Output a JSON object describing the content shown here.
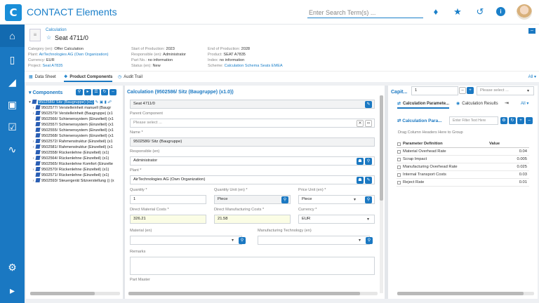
{
  "app": {
    "title": "CONTACT Elements",
    "logo_letter": "C",
    "search_placeholder": "Enter Search Term(s) ..."
  },
  "top_icons": [
    "bell-icon",
    "star-icon",
    "history-icon",
    "info-icon",
    "user-avatar"
  ],
  "sidebar": {
    "items": [
      "home-icon",
      "document-icon",
      "structure-icon",
      "monitor-icon",
      "checklist-icon",
      "pulse-icon",
      "settings-icon",
      "expand-icon"
    ]
  },
  "header": {
    "breadcrumb": "Calculation",
    "title": "Seat 4711/0",
    "col1": [
      {
        "label": "Category (en):",
        "value": "Offer Calculation",
        "link": false
      },
      {
        "label": "Plant:",
        "value": "AirTechnologies AG (Own Organization)",
        "link": true
      },
      {
        "label": "Currency:",
        "value": "EUR",
        "link": false
      },
      {
        "label": "Project:",
        "value": "Seat A7835",
        "link": true
      }
    ],
    "col2": [
      {
        "label": "Start of Production:",
        "value": "2023",
        "link": false
      },
      {
        "label": "Responsible (en):",
        "value": "Administrator",
        "link": false
      },
      {
        "label": "Part No.:",
        "value": "no information",
        "link": false
      },
      {
        "label": "Status (en):",
        "value": "New",
        "link": false
      }
    ],
    "col3": [
      {
        "label": "End of Production:",
        "value": "2028",
        "link": false
      },
      {
        "label": "Product:",
        "value": "SEAT A7835",
        "link": false
      },
      {
        "label": "Index:",
        "value": "no information",
        "link": false
      },
      {
        "label": "Scheme:",
        "value": "Calculation Schema Seats EMEA",
        "link": true
      }
    ],
    "tabs": [
      "Data Sheet",
      "Product Components",
      "Audit Trail"
    ],
    "active_tab": "Product Components",
    "tabs_filter": "All"
  },
  "components": {
    "title": "Components",
    "tree": [
      {
        "label": "9502586/ Sitz (Baugruppe) (x1)",
        "level": 0,
        "expanded": true,
        "selected": true
      },
      {
        "label": "9502577/ Verstelleinheit manuell (Baugr",
        "level": 1
      },
      {
        "label": "9502579/ Verstelleinheit (Baugruppe) (x1",
        "level": 1
      },
      {
        "label": "9502566/ Schienensystem (Einzelteil) (x1",
        "level": 1
      },
      {
        "label": "9502557/ Schienensystem (Einzelteil) (x1",
        "level": 1
      },
      {
        "label": "9502555/ Schienensystem (Einzelteil) (x1",
        "level": 1
      },
      {
        "label": "9502568/ Schienensystem (Einzelteil) (x1",
        "level": 1
      },
      {
        "label": "9502572/ Rahmenstruktur (Einzelteil) (x1",
        "level": 1
      },
      {
        "label": "9502581/ Rahmenstruktur (Einzelteil) (x1",
        "level": 1
      },
      {
        "label": "9502558/ Rückenlehne (Einzelteil) (x1)",
        "level": 1
      },
      {
        "label": "9502564/ Rückenlehne (Einzelteil) (x1)",
        "level": 1
      },
      {
        "label": "9502565/ Rückenlehne Komfort (Einzelte",
        "level": 1
      },
      {
        "label": "9502570/ Rückenlehne (Einzelteil) (x1)",
        "level": 1
      },
      {
        "label": "9502571/ Rückenlehne (Einzelteil) (x1)",
        "level": 1
      },
      {
        "label": "9502593/ Steuergerät Sitzverstellung () (x",
        "level": 1
      }
    ]
  },
  "calc": {
    "title": "Calculation (9502586/ Sitz (Baugruppe) (x1.0))",
    "top_value": "Seat 4711/0",
    "parent_label": "Parent Component",
    "parent_placeholder": "Please select ...",
    "name_label": "Name *",
    "name_value": "9502586/ Sitz (Baugruppe)",
    "responsible_label": "Responsible (en)",
    "responsible_value": "Administrator",
    "plant_label": "Plant *",
    "plant_value": "AirTechnologies AG (Own Organization)",
    "quantity_label": "Quantity *",
    "quantity_value": "1",
    "qunit_label": "Quantity Unit (en) *",
    "qunit_value": "Piece",
    "punit_label": "Price Unit (en) *",
    "punit_value": "Piece",
    "dmc_label": "Direct Material Costs *",
    "dmc_value": "326.21",
    "dmfc_label": "Direct Manufacturing Costs *",
    "dmfc_value": "21.58",
    "currency_label": "Currency *",
    "currency_value": "EUR",
    "material_label": "Material (en)",
    "mtech_label": "Manufacturing Technology (en)",
    "remarks_label": "Remarks",
    "partmaster_label": "Part Master"
  },
  "right": {
    "title": "Capit...",
    "quantity_value": "1",
    "select_placeholder": "Please select ...",
    "tabs": [
      "Calculation Paramete...",
      "Calculation Results"
    ],
    "tabs_filter": "All",
    "subtitle": "Calculation Para...",
    "filter_placeholder": "Enter Filter Text Here",
    "group_hint": "Drag Column Headers Here to Group",
    "col_param": "Parameter Definition",
    "col_value": "Value",
    "rows": [
      {
        "name": "Material Overhead Rate",
        "value": "0.04"
      },
      {
        "name": "Scrap Impact",
        "value": "0.005"
      },
      {
        "name": "Manufacturing Overhead Rate",
        "value": "0.025"
      },
      {
        "name": "Internal Transport Costs",
        "value": "0.03"
      },
      {
        "name": "Reject Rate",
        "value": "0.01"
      }
    ]
  }
}
